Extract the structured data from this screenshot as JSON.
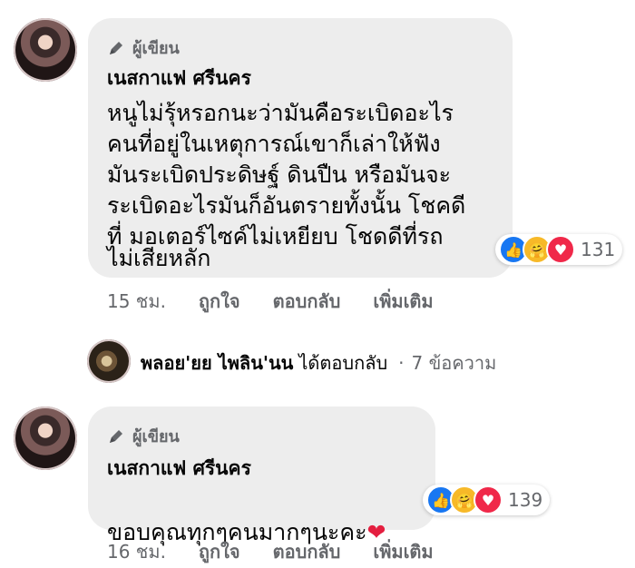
{
  "comment1": {
    "badge": "ผู้เขียน",
    "author": "เนสกาแฟ ศรีนคร",
    "lines": [
      "หนูไม่รุ้หรอกนะว่ามันคือระเบิดอะไร",
      "คนที่อยู่ในเหตุการณ์เขาก็เล่าให้ฟัง",
      "มันระเบิดประดิษฐ์ ดินปืน หรือมันจะ",
      "ระเบิดอะไรมันก็อันตรายทั้งนั้น โชคดี",
      "ที่ มอเตอร์ไซค์ไม่เหยียบ โชดดีที่รถ",
      "ไม่เสียหลัก"
    ],
    "reaction_count": "131",
    "time": "15 ชม.",
    "like": "ถูกใจ",
    "reply": "ตอบกลับ",
    "more": "เพิ่มเติม"
  },
  "reply_summary": {
    "name": "พลอย'ยย ไพลิน'นน",
    "verb": "ได้ตอบกลับ",
    "separator": "·",
    "count": "7 ข้อความ"
  },
  "comment2": {
    "badge": "ผู้เขียน",
    "author": "เนสกาแฟ ศรีนคร",
    "text": "ขอบคุณทุกๆคนมากๆนะคะ",
    "emoji": "❤",
    "reaction_count": "139",
    "time": "16 ชม.",
    "like": "ถูกใจ",
    "reply": "ตอบกลับ",
    "more": "เพิ่มเติม"
  }
}
